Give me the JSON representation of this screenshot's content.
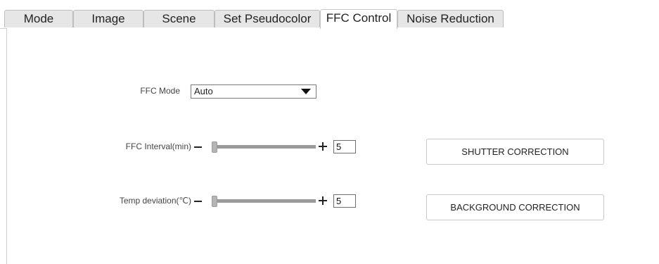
{
  "tabs": [
    {
      "label": "Mode",
      "active": false
    },
    {
      "label": "Image",
      "active": false
    },
    {
      "label": "Scene",
      "active": false
    },
    {
      "label": "Set Pseudocolor",
      "active": false
    },
    {
      "label": "FFC Control",
      "active": true
    },
    {
      "label": "Noise Reduction",
      "active": false
    }
  ],
  "ffc_mode": {
    "label": "FFC Mode",
    "value": "Auto"
  },
  "ffc_interval": {
    "label": "FFC Interval(min)",
    "value": "5",
    "slider_fraction": 0.0
  },
  "temp_deviation": {
    "label": "Temp deviation(℃)",
    "value": "5",
    "slider_fraction": 0.0
  },
  "buttons": {
    "shutter_correction": "SHUTTER CORRECTION",
    "background_correction": "BACKGROUND CORRECTION"
  }
}
